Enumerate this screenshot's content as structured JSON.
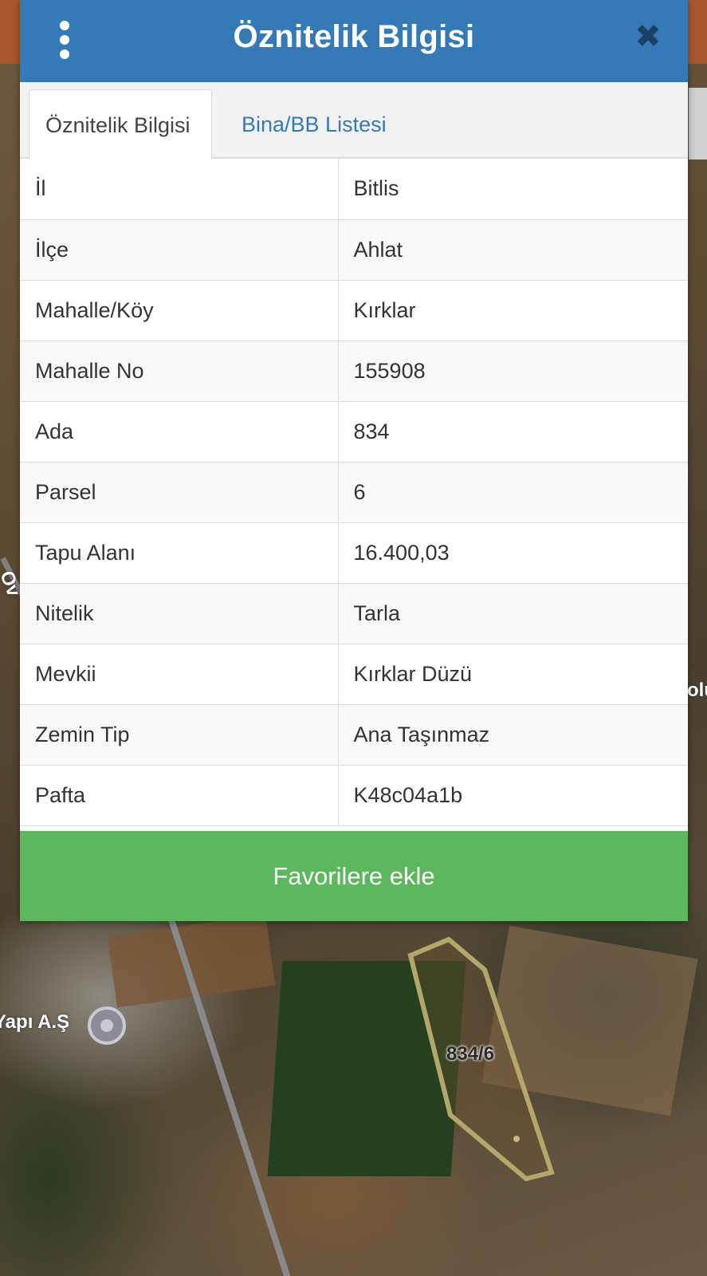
{
  "header": {
    "title": "Öznitelik Bilgisi",
    "menu_icon": "more-vertical-icon",
    "close_icon": "close-icon",
    "color": "#337ab7"
  },
  "tabs": [
    {
      "label": "Öznitelik Bilgisi",
      "active": true
    },
    {
      "label": "Bina/BB Listesi",
      "active": false
    }
  ],
  "attributes": [
    {
      "key": "İl",
      "value": "Bitlis"
    },
    {
      "key": "İlçe",
      "value": "Ahlat"
    },
    {
      "key": "Mahalle/Köy",
      "value": "Kırklar"
    },
    {
      "key": "Mahalle No",
      "value": "155908"
    },
    {
      "key": "Ada",
      "value": "834"
    },
    {
      "key": "Parsel",
      "value": "6"
    },
    {
      "key": "Tapu Alanı",
      "value": "16.400,03"
    },
    {
      "key": "Nitelik",
      "value": "Tarla"
    },
    {
      "key": "Mevkii",
      "value": "Kırklar Düzü"
    },
    {
      "key": "Zemin Tip",
      "value": "Ana Taşınmaz"
    },
    {
      "key": "Pafta",
      "value": "K48c04a1b"
    }
  ],
  "actions": {
    "favorite_label": "Favorilere ekle",
    "favorite_color": "#5cb85c"
  },
  "map": {
    "parcel_label": "834/6",
    "place_label": "Yapı A.Ş",
    "edge_label_left": "Ov",
    "edge_label_right": "olu"
  }
}
